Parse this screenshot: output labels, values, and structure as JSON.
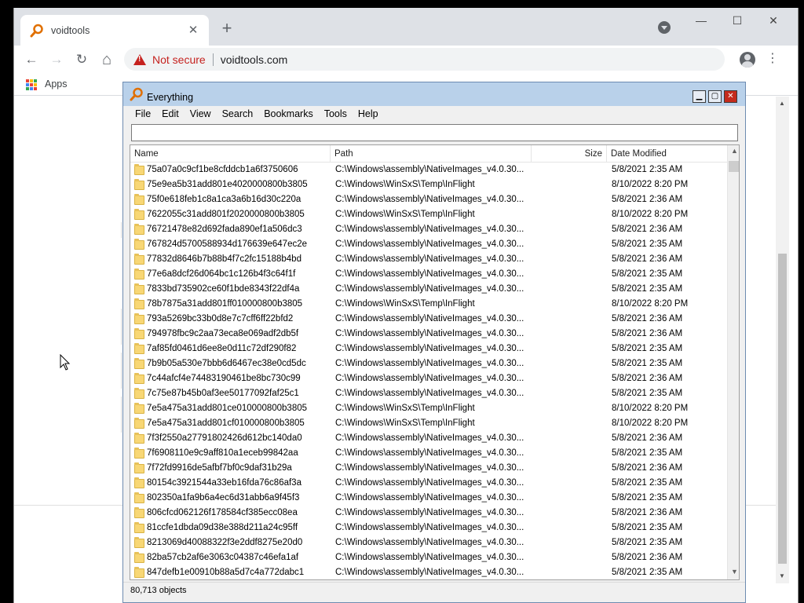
{
  "browser": {
    "tab": {
      "title": "voidtools",
      "close_glyph": "✕"
    },
    "newtab_glyph": "+",
    "window_controls": {
      "minimize": "—",
      "maximize": "☐",
      "close": "✕"
    },
    "toolbar": {
      "back_glyph": "←",
      "forward_glyph": "→",
      "reload_glyph": "↻",
      "home_glyph": "⌂",
      "security_label": "Not secure",
      "url": "voidtools.com",
      "star_glyph": "☆",
      "menu_glyph": "⋮"
    },
    "bookmarks": {
      "apps_label": "Apps"
    },
    "colors": {
      "not_secure": "#c5221f",
      "tabstrip": "#dee1e6"
    }
  },
  "everything": {
    "title": "Everything",
    "controls": {
      "minimize": "▁",
      "maximize": "▢",
      "close": "✕"
    },
    "menu": [
      "File",
      "Edit",
      "View",
      "Search",
      "Bookmarks",
      "Tools",
      "Help"
    ],
    "search": {
      "value": "",
      "placeholder": ""
    },
    "columns": {
      "name": "Name",
      "path": "Path",
      "size": "Size",
      "date": "Date Modified"
    },
    "rows": [
      {
        "name": "75a07a0c9cf1be8cfddcb1a6f3750606",
        "path": "C:\\Windows\\assembly\\NativeImages_v4.0.30...",
        "size": "",
        "date": "5/8/2021 2:35 AM"
      },
      {
        "name": "75e9ea5b31add801e4020000800b3805",
        "path": "C:\\Windows\\WinSxS\\Temp\\InFlight",
        "size": "",
        "date": "8/10/2022 8:20 PM"
      },
      {
        "name": "75f0e618feb1c8a1ca3a6b16d30c220a",
        "path": "C:\\Windows\\assembly\\NativeImages_v4.0.30...",
        "size": "",
        "date": "5/8/2021 2:36 AM"
      },
      {
        "name": "7622055c31add801f2020000800b3805",
        "path": "C:\\Windows\\WinSxS\\Temp\\InFlight",
        "size": "",
        "date": "8/10/2022 8:20 PM"
      },
      {
        "name": "76721478e82d692fada890ef1a506dc3",
        "path": "C:\\Windows\\assembly\\NativeImages_v4.0.30...",
        "size": "",
        "date": "5/8/2021 2:36 AM"
      },
      {
        "name": "767824d5700588934d176639e647ec2e",
        "path": "C:\\Windows\\assembly\\NativeImages_v4.0.30...",
        "size": "",
        "date": "5/8/2021 2:35 AM"
      },
      {
        "name": "77832d8646b7b88b4f7c2fc15188b4bd",
        "path": "C:\\Windows\\assembly\\NativeImages_v4.0.30...",
        "size": "",
        "date": "5/8/2021 2:36 AM"
      },
      {
        "name": "77e6a8dcf26d064bc1c126b4f3c64f1f",
        "path": "C:\\Windows\\assembly\\NativeImages_v4.0.30...",
        "size": "",
        "date": "5/8/2021 2:35 AM"
      },
      {
        "name": "7833bd735902ce60f1bde8343f22df4a",
        "path": "C:\\Windows\\assembly\\NativeImages_v4.0.30...",
        "size": "",
        "date": "5/8/2021 2:35 AM"
      },
      {
        "name": "78b7875a31add801ff010000800b3805",
        "path": "C:\\Windows\\WinSxS\\Temp\\InFlight",
        "size": "",
        "date": "8/10/2022 8:20 PM"
      },
      {
        "name": "793a5269bc33b0d8e7c7cff6ff22bfd2",
        "path": "C:\\Windows\\assembly\\NativeImages_v4.0.30...",
        "size": "",
        "date": "5/8/2021 2:36 AM"
      },
      {
        "name": "794978fbc9c2aa73eca8e069adf2db5f",
        "path": "C:\\Windows\\assembly\\NativeImages_v4.0.30...",
        "size": "",
        "date": "5/8/2021 2:36 AM"
      },
      {
        "name": "7af85fd0461d6ee8e0d11c72df290f82",
        "path": "C:\\Windows\\assembly\\NativeImages_v4.0.30...",
        "size": "",
        "date": "5/8/2021 2:35 AM"
      },
      {
        "name": "7b9b05a530e7bbb6d6467ec38e0cd5dc",
        "path": "C:\\Windows\\assembly\\NativeImages_v4.0.30...",
        "size": "",
        "date": "5/8/2021 2:35 AM"
      },
      {
        "name": "7c44afcf4e74483190461be8bc730c99",
        "path": "C:\\Windows\\assembly\\NativeImages_v4.0.30...",
        "size": "",
        "date": "5/8/2021 2:36 AM"
      },
      {
        "name": "7c75e87b45b0af3ee50177092faf25c1",
        "path": "C:\\Windows\\assembly\\NativeImages_v4.0.30...",
        "size": "",
        "date": "5/8/2021 2:35 AM"
      },
      {
        "name": "7e5a475a31add801ce010000800b3805",
        "path": "C:\\Windows\\WinSxS\\Temp\\InFlight",
        "size": "",
        "date": "8/10/2022 8:20 PM"
      },
      {
        "name": "7e5a475a31add801cf010000800b3805",
        "path": "C:\\Windows\\WinSxS\\Temp\\InFlight",
        "size": "",
        "date": "8/10/2022 8:20 PM"
      },
      {
        "name": "7f3f2550a27791802426d612bc140da0",
        "path": "C:\\Windows\\assembly\\NativeImages_v4.0.30...",
        "size": "",
        "date": "5/8/2021 2:36 AM"
      },
      {
        "name": "7f6908110e9c9aff810a1eceb99842aa",
        "path": "C:\\Windows\\assembly\\NativeImages_v4.0.30...",
        "size": "",
        "date": "5/8/2021 2:35 AM"
      },
      {
        "name": "7f72fd9916de5afbf7bf0c9daf31b29a",
        "path": "C:\\Windows\\assembly\\NativeImages_v4.0.30...",
        "size": "",
        "date": "5/8/2021 2:36 AM"
      },
      {
        "name": "80154c3921544a33eb16fda76c86af3a",
        "path": "C:\\Windows\\assembly\\NativeImages_v4.0.30...",
        "size": "",
        "date": "5/8/2021 2:35 AM"
      },
      {
        "name": "802350a1fa9b6a4ec6d31abb6a9f45f3",
        "path": "C:\\Windows\\assembly\\NativeImages_v4.0.30...",
        "size": "",
        "date": "5/8/2021 2:35 AM"
      },
      {
        "name": "806cfcd062126f178584cf385ecc08ea",
        "path": "C:\\Windows\\assembly\\NativeImages_v4.0.30...",
        "size": "",
        "date": "5/8/2021 2:36 AM"
      },
      {
        "name": "81ccfe1dbda09d38e388d211a24c95ff",
        "path": "C:\\Windows\\assembly\\NativeImages_v4.0.30...",
        "size": "",
        "date": "5/8/2021 2:35 AM"
      },
      {
        "name": "8213069d40088322f3e2ddf8275e20d0",
        "path": "C:\\Windows\\assembly\\NativeImages_v4.0.30...",
        "size": "",
        "date": "5/8/2021 2:35 AM"
      },
      {
        "name": "82ba57cb2af6e3063c04387c46efa1af",
        "path": "C:\\Windows\\assembly\\NativeImages_v4.0.30...",
        "size": "",
        "date": "5/8/2021 2:36 AM"
      },
      {
        "name": "847defb1e00910b88a5d7c4a772dabc1",
        "path": "C:\\Windows\\assembly\\NativeImages_v4.0.30...",
        "size": "",
        "date": "5/8/2021 2:35 AM"
      }
    ],
    "status": "80,713 objects",
    "colors": {
      "titlebar": "#b9d1ea",
      "folder": "#f8d775",
      "close": "#c42b1c"
    }
  }
}
